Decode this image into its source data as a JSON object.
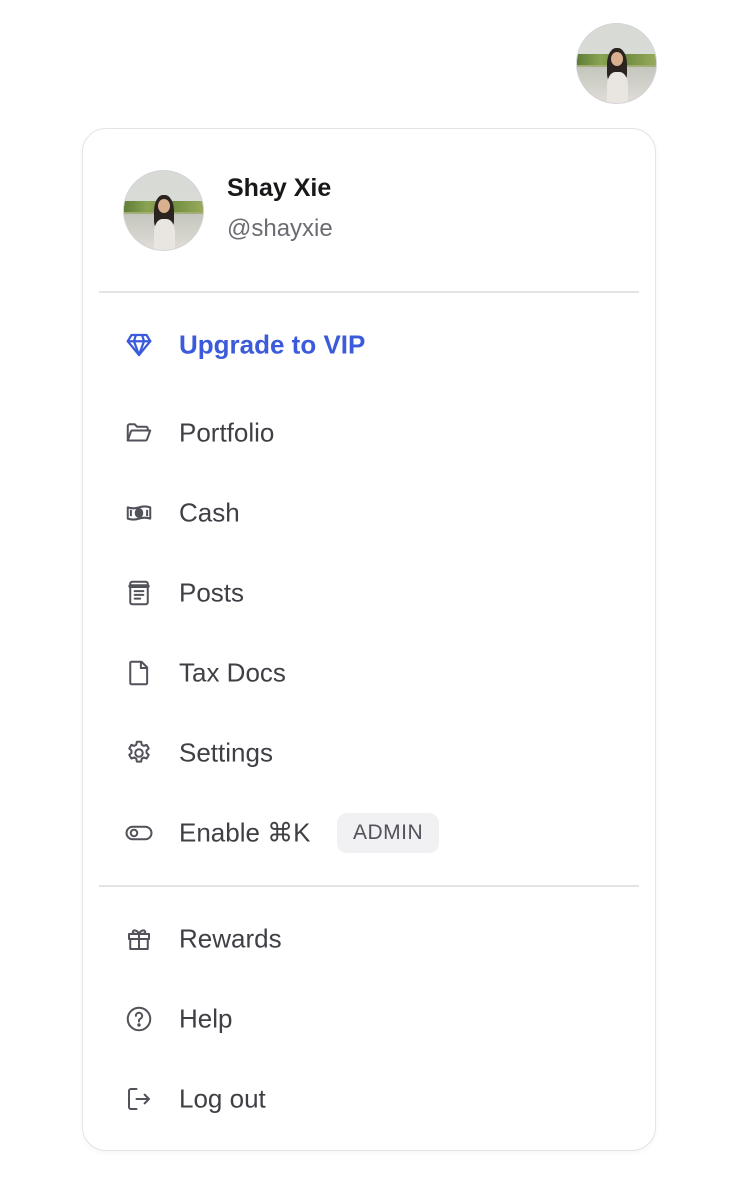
{
  "user": {
    "name": "Shay Xie",
    "handle": "@shayxie"
  },
  "menu": {
    "primary": [
      {
        "id": "upgrade",
        "label": "Upgrade to VIP",
        "icon": "diamond-icon"
      },
      {
        "id": "portfolio",
        "label": "Portfolio",
        "icon": "folder-open-icon"
      },
      {
        "id": "cash",
        "label": "Cash",
        "icon": "banknote-icon"
      },
      {
        "id": "posts",
        "label": "Posts",
        "icon": "document-lines-icon"
      },
      {
        "id": "tax-docs",
        "label": "Tax Docs",
        "icon": "file-icon"
      },
      {
        "id": "settings",
        "label": "Settings",
        "icon": "gear-icon"
      },
      {
        "id": "enable-cmdk",
        "label": "Enable ⌘K",
        "icon": "toggle-icon",
        "badge": "ADMIN"
      }
    ],
    "secondary": [
      {
        "id": "rewards",
        "label": "Rewards",
        "icon": "gift-icon"
      },
      {
        "id": "help",
        "label": "Help",
        "icon": "help-circle-icon"
      },
      {
        "id": "logout",
        "label": "Log out",
        "icon": "logout-icon"
      }
    ]
  },
  "colors": {
    "accent": "#3b5bdb",
    "text": "#3f3f46",
    "icon": "#52525b",
    "border": "#e4e4e7"
  }
}
